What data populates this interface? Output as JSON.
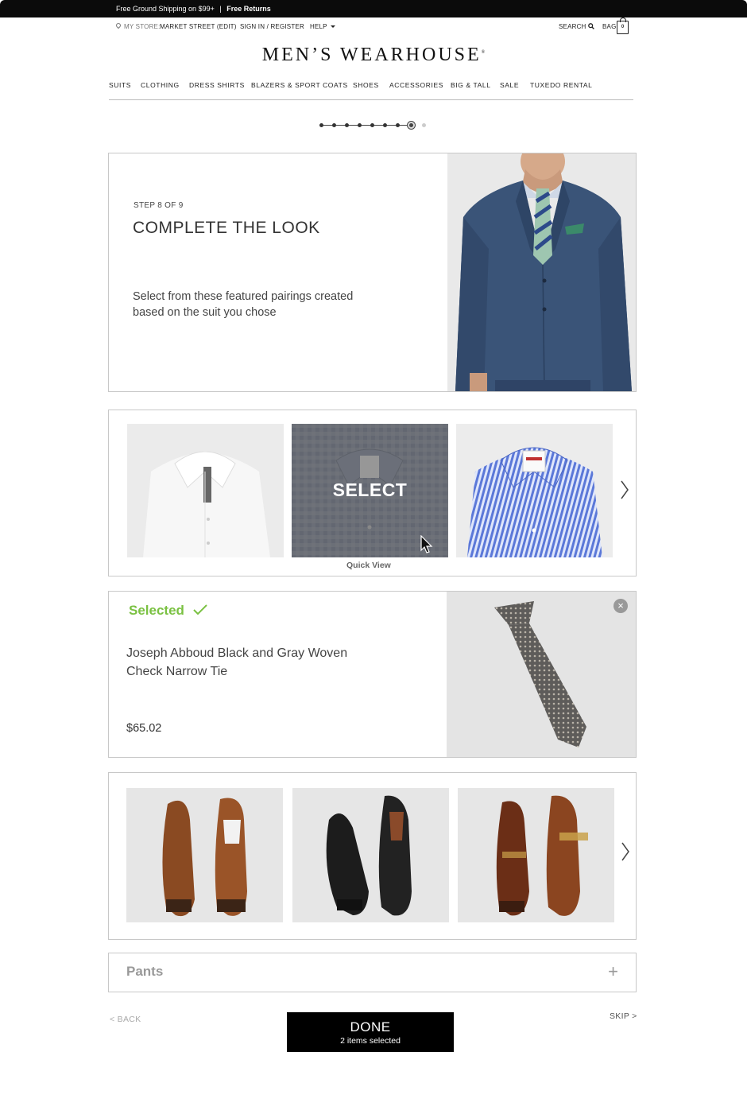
{
  "promo": {
    "shipping": "Free Ground Shipping on $99+",
    "separator": "|",
    "returns": "Free Returns"
  },
  "utility": {
    "store_prefix": "MY STORE:",
    "store_name": "MARKET STREET (EDIT)",
    "sign_in": "SIGN IN / REGISTER",
    "help": "HELP",
    "search": "SEARCH",
    "bag": "BAG",
    "bag_count": "0"
  },
  "brand": {
    "logo": "MEN’S WEARHOUSE",
    "reg": "®"
  },
  "nav": [
    "SUITS",
    "CLOTHING",
    "DRESS SHIRTS",
    "BLAZERS & SPORT COATS",
    "SHOES",
    "ACCESSORIES",
    "BIG & TALL",
    "SALE",
    "TUXEDO RENTAL"
  ],
  "progress": {
    "current_step": 8,
    "total_steps": 9
  },
  "hero": {
    "step": "STEP 8 OF 9",
    "title": "COMPLETE THE LOOK",
    "description": "Select from these featured pairings created based on the suit you chose"
  },
  "shirts": {
    "hover_label": "SELECT",
    "quick_view": "Quick View",
    "items": [
      {
        "name": "white-shirt"
      },
      {
        "name": "gray-check-shirt"
      },
      {
        "name": "blue-stripe-shirt"
      }
    ]
  },
  "selected": {
    "label": "Selected",
    "product_name": "Joseph Abboud Black and Gray Woven Check Narrow Tie",
    "price": "$65.02",
    "remove_symbol": "×"
  },
  "shoes": {
    "items": [
      {
        "name": "brown-oxford-shoes"
      },
      {
        "name": "black-lace-up-shoes"
      },
      {
        "name": "brown-monk-strap-shoes"
      }
    ]
  },
  "pants": {
    "label": "Pants",
    "expand_symbol": "+"
  },
  "footer": {
    "back": "< BACK",
    "skip": "SKIP >",
    "done": "DONE",
    "done_sub": "2 items selected"
  },
  "colors": {
    "accent_green": "#7ac142",
    "black": "#000000",
    "border": "#c8c8c8"
  }
}
